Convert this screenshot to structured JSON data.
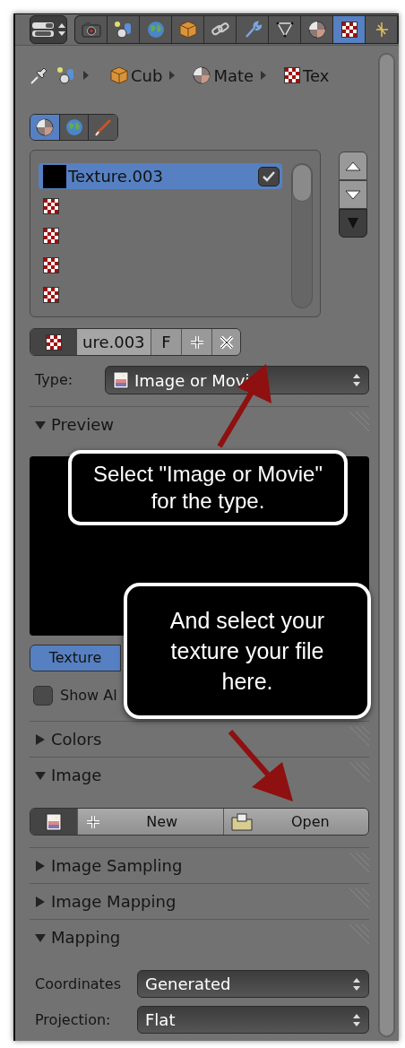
{
  "header": {
    "tabs": [
      {
        "kind": "camera",
        "selected": false
      },
      {
        "kind": "scene",
        "selected": false
      },
      {
        "kind": "world",
        "selected": false
      },
      {
        "kind": "object",
        "selected": false
      },
      {
        "kind": "constraint",
        "selected": false
      },
      {
        "kind": "modifier",
        "selected": false
      },
      {
        "kind": "data",
        "selected": false
      },
      {
        "kind": "material",
        "selected": false
      },
      {
        "kind": "texture",
        "selected": true
      },
      {
        "kind": "particles",
        "selected": false
      }
    ]
  },
  "breadcrumb": [
    {
      "kind": "pin"
    },
    {
      "kind": "scene"
    },
    {
      "kind": "object",
      "label": "Cub"
    },
    {
      "kind": "material",
      "label": "Mate"
    },
    {
      "kind": "texture",
      "label": "Tex"
    }
  ],
  "context_buttons": [
    {
      "kind": "material",
      "selected": true
    },
    {
      "kind": "world",
      "selected": false
    },
    {
      "kind": "brush",
      "selected": false
    }
  ],
  "texture_list": {
    "rows": [
      {
        "kind": "swatch",
        "label": "Texture.003",
        "selected": true,
        "checked": true
      },
      {
        "kind": "checker",
        "selected": false
      },
      {
        "kind": "checker",
        "selected": false
      },
      {
        "kind": "checker",
        "selected": false
      },
      {
        "kind": "checker",
        "selected": false
      }
    ]
  },
  "id_block": {
    "name": "ure.003",
    "fake_user": "F"
  },
  "type": {
    "label": "Type:",
    "value": "Image or Movi"
  },
  "sections": [
    {
      "kind": "preview",
      "title": "Preview",
      "expanded": true,
      "button": {
        "label": "Texture",
        "selected": true
      },
      "checkbox": {
        "label": "Show Al",
        "checked": false
      }
    },
    {
      "title": "Colors",
      "expanded": false
    },
    {
      "kind": "image",
      "title": "Image",
      "expanded": true,
      "buttons": [
        {
          "kind": "new",
          "label": "New"
        },
        {
          "kind": "open",
          "label": "Open"
        }
      ]
    },
    {
      "title": "Image Sampling",
      "expanded": false
    },
    {
      "title": "Image Mapping",
      "expanded": false
    },
    {
      "kind": "mapping",
      "title": "Mapping",
      "expanded": true,
      "fields": [
        {
          "label": "Coordinates",
          "value": "Generated"
        },
        {
          "label": "Projection:",
          "value": "Flat"
        }
      ]
    }
  ],
  "callouts": [
    {
      "text": "Select \"Image or Movie\" for the type."
    },
    {
      "text": "And select your texture your file here."
    }
  ]
}
